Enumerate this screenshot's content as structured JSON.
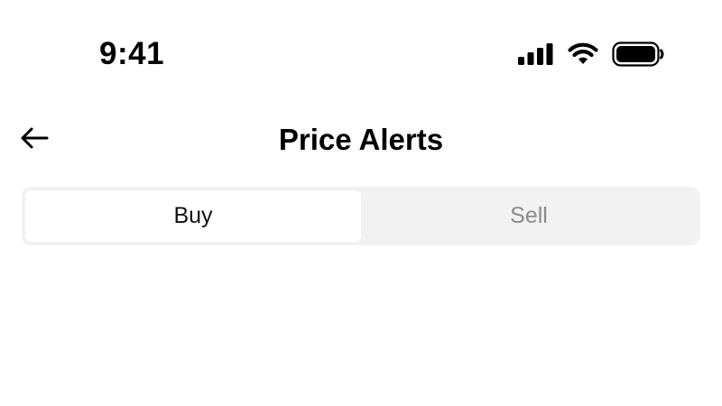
{
  "status_bar": {
    "time": "9:41",
    "icons": [
      "cellular-signal-icon",
      "wifi-icon",
      "battery-icon"
    ]
  },
  "nav": {
    "back_icon": "arrow-left-icon",
    "title": "Price Alerts"
  },
  "tabs": [
    {
      "label": "Buy",
      "selected": true
    },
    {
      "label": "Sell",
      "selected": false
    }
  ],
  "colors": {
    "background": "#ffffff",
    "segment_track": "#f2f2f2",
    "active_text": "#111111",
    "inactive_text": "#8a8a8a"
  }
}
